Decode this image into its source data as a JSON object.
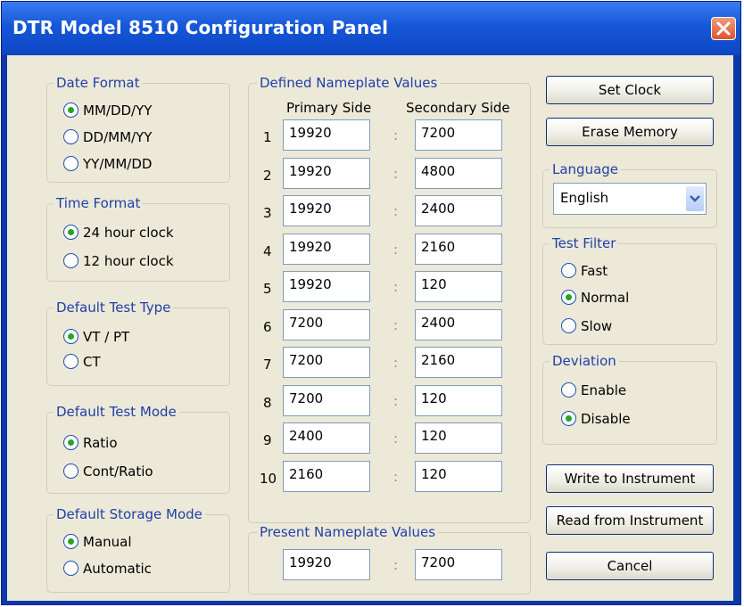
{
  "window": {
    "title": "DTR Model 8510 Configuration Panel"
  },
  "date_format": {
    "label": "Date Format",
    "options": [
      "MM/DD/YY",
      "DD/MM/YY",
      "YY/MM/DD"
    ],
    "selected": "MM/DD/YY"
  },
  "time_format": {
    "label": "Time Format",
    "options": [
      "24 hour clock",
      "12 hour clock"
    ],
    "selected": "24 hour clock"
  },
  "default_test_type": {
    "label": "Default Test Type",
    "options": [
      "VT / PT",
      "CT"
    ],
    "selected": "VT / PT"
  },
  "default_test_mode": {
    "label": "Default Test Mode",
    "options": [
      "Ratio",
      "Cont/Ratio"
    ],
    "selected": "Ratio"
  },
  "default_storage_mode": {
    "label": "Default Storage Mode",
    "options": [
      "Manual",
      "Automatic"
    ],
    "selected": "Manual"
  },
  "defined_nameplate": {
    "label": "Defined Nameplate Values",
    "primary_header": "Primary Side",
    "secondary_header": "Secondary Side",
    "separator": ":",
    "rows": [
      {
        "num": "1",
        "primary": "19920",
        "secondary": "7200"
      },
      {
        "num": "2",
        "primary": "19920",
        "secondary": "4800"
      },
      {
        "num": "3",
        "primary": "19920",
        "secondary": "2400"
      },
      {
        "num": "4",
        "primary": "19920",
        "secondary": "2160"
      },
      {
        "num": "5",
        "primary": "19920",
        "secondary": "120"
      },
      {
        "num": "6",
        "primary": "7200",
        "secondary": "2400"
      },
      {
        "num": "7",
        "primary": "7200",
        "secondary": "2160"
      },
      {
        "num": "8",
        "primary": "7200",
        "secondary": "120"
      },
      {
        "num": "9",
        "primary": "2400",
        "secondary": "120"
      },
      {
        "num": "10",
        "primary": "2160",
        "secondary": "120"
      }
    ]
  },
  "present_nameplate": {
    "label": "Present Nameplate Values",
    "primary": "19920",
    "separator": ":",
    "secondary": "7200"
  },
  "buttons": {
    "set_clock": "Set Clock",
    "erase_memory": "Erase Memory",
    "write": "Write to Instrument",
    "read": "Read from Instrument",
    "cancel": "Cancel"
  },
  "language": {
    "label": "Language",
    "value": "English"
  },
  "test_filter": {
    "label": "Test Filter",
    "options": [
      "Fast",
      "Normal",
      "Slow"
    ],
    "selected": "Normal"
  },
  "deviation": {
    "label": "Deviation",
    "options": [
      "Enable",
      "Disable"
    ],
    "selected": "Disable"
  },
  "colors": {
    "title_bar": "#1657d8",
    "group_label": "#1f3fa8",
    "dialog_bg": "#ece9d8",
    "radio_selected": "#24a624",
    "close_button": "#e0542c"
  },
  "icons": {
    "close": "close-icon",
    "dropdown": "chevron-down-icon"
  }
}
